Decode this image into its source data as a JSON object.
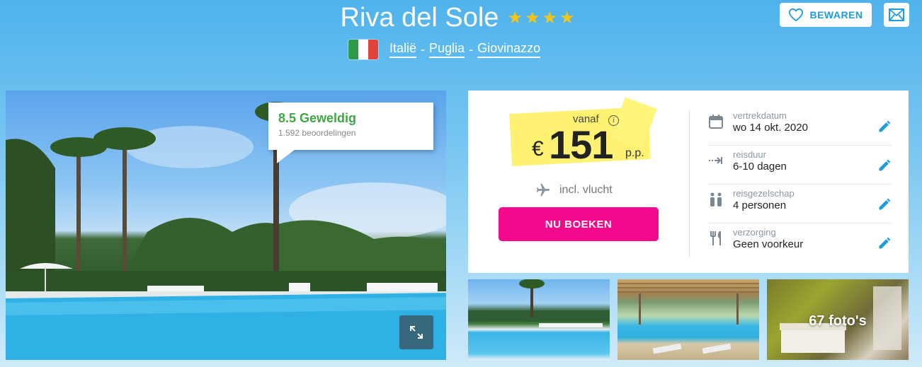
{
  "hotel": {
    "name": "Riva del Sole",
    "stars": 4
  },
  "location": {
    "country": "Italië",
    "region": "Puglia",
    "city": "Giovinazzo",
    "separator": "-"
  },
  "actions": {
    "save_label": "BEWAREN",
    "mail_icon": "mail-icon",
    "save_icon": "heart-icon"
  },
  "review": {
    "score_text": "8.5 Geweldig",
    "count_text": "1.592 beoordelingen"
  },
  "booking": {
    "vanaf_label": "vanaf",
    "currency": "€",
    "price": "151",
    "per_person": "p.p.",
    "flight_text": "incl. vlucht",
    "book_label": "NU BOEKEN"
  },
  "details": [
    {
      "label": "vertrekdatum",
      "value": "wo 14 okt. 2020",
      "icon": "calendar-icon"
    },
    {
      "label": "reisduur",
      "value": "6-10 dagen",
      "icon": "duration-icon"
    },
    {
      "label": "reisgezelschap",
      "value": "4 personen",
      "icon": "people-icon"
    },
    {
      "label": "verzorging",
      "value": "Geen voorkeur",
      "icon": "cutlery-icon"
    }
  ],
  "gallery": {
    "photos_label": "67 foto's"
  },
  "colors": {
    "accent": "#1f9be0",
    "book_button": "#f2098c",
    "review_green": "#3fa744",
    "star": "#f5c518",
    "highlight": "#fff06a"
  }
}
